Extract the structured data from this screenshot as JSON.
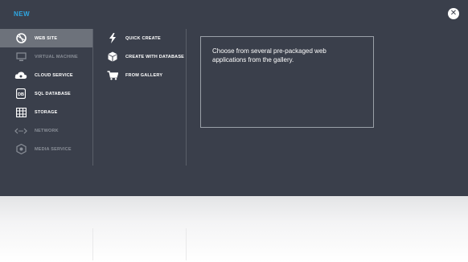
{
  "header": {
    "new_label": "NEW",
    "close_icon": "close-icon"
  },
  "categories": [
    {
      "label": "WEB SITE",
      "icon": "web-site-icon",
      "selected": true,
      "enabled": true
    },
    {
      "label": "VIRTUAL MACHINE",
      "icon": "virtual-machine-icon",
      "selected": false,
      "enabled": false
    },
    {
      "label": "CLOUD SERVICE",
      "icon": "cloud-service-icon",
      "selected": false,
      "enabled": true
    },
    {
      "label": "SQL DATABASE",
      "icon": "sql-database-icon",
      "selected": false,
      "enabled": true
    },
    {
      "label": "STORAGE",
      "icon": "storage-icon",
      "selected": false,
      "enabled": true
    },
    {
      "label": "NETWORK",
      "icon": "network-icon",
      "selected": false,
      "enabled": false
    },
    {
      "label": "MEDIA SERVICE",
      "icon": "media-service-icon",
      "selected": false,
      "enabled": false
    }
  ],
  "options": [
    {
      "label": "QUICK CREATE",
      "icon": "lightning-icon"
    },
    {
      "label": "CREATE WITH DATABASE",
      "icon": "box-icon"
    },
    {
      "label": "FROM GALLERY",
      "icon": "cart-icon"
    }
  ],
  "description": "Choose from several pre-packaged web applications from the gallery.",
  "colors": {
    "panel": "#3a3f4b",
    "selected": "#6d727b",
    "accent": "#2fa6e0"
  }
}
